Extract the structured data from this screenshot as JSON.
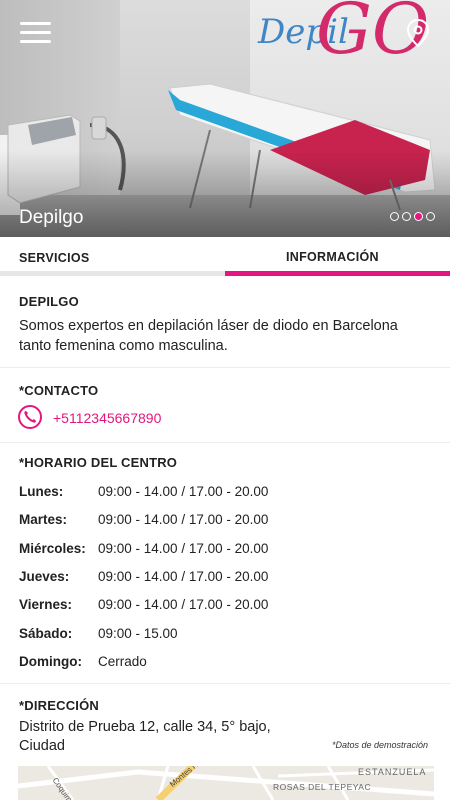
{
  "hero": {
    "brand_part1": "Depil",
    "brand_part2": "GO",
    "title": "Depilgo",
    "carousel_pages": 4,
    "carousel_active_index": 2
  },
  "tabs": [
    {
      "label": "SERVICIOS",
      "active": false
    },
    {
      "label": "INFORMACIÓN",
      "active": true
    }
  ],
  "colors": {
    "accent": "#e3177f",
    "brand_blue": "#3f86c6",
    "brand_pink": "#d22a6a"
  },
  "about": {
    "heading": "DEPILGO",
    "text": "Somos expertos en depilación láser de diodo en Barcelona tanto femenina como masculina."
  },
  "contact": {
    "heading": "*CONTACTO",
    "phone_icon": "phone-icon",
    "phone": "+5112345667890"
  },
  "schedule": {
    "heading": "*HORARIO DEL CENTRO",
    "rows": [
      {
        "day": "Lunes:",
        "hours": "09:00 - 14.00  /  17.00 - 20.00"
      },
      {
        "day": "Martes:",
        "hours": "09:00 - 14.00  /  17.00 - 20.00"
      },
      {
        "day": "Miércoles:",
        "hours": "09:00 - 14.00  /  17.00 - 20.00"
      },
      {
        "day": "Jueves:",
        "hours": "09:00 - 14.00  /  17.00 - 20.00"
      },
      {
        "day": "Viernes:",
        "hours": "09:00 - 14.00  /  17.00 - 20.00"
      },
      {
        "day": "Sábado:",
        "hours": "09:00 - 15.00"
      },
      {
        "day": "Domingo:",
        "hours": "Cerrado"
      }
    ]
  },
  "address": {
    "heading": "*DIRECCIÓN",
    "text": "Distrito de Prueba 12, calle 34, 5° bajo, Ciudad",
    "demo_note": "*Datos de demostración"
  },
  "map": {
    "labels": [
      "Coquimbo",
      "ESTANZUELA",
      "ROSAS DEL TEPEYAC",
      "Montes N"
    ]
  }
}
